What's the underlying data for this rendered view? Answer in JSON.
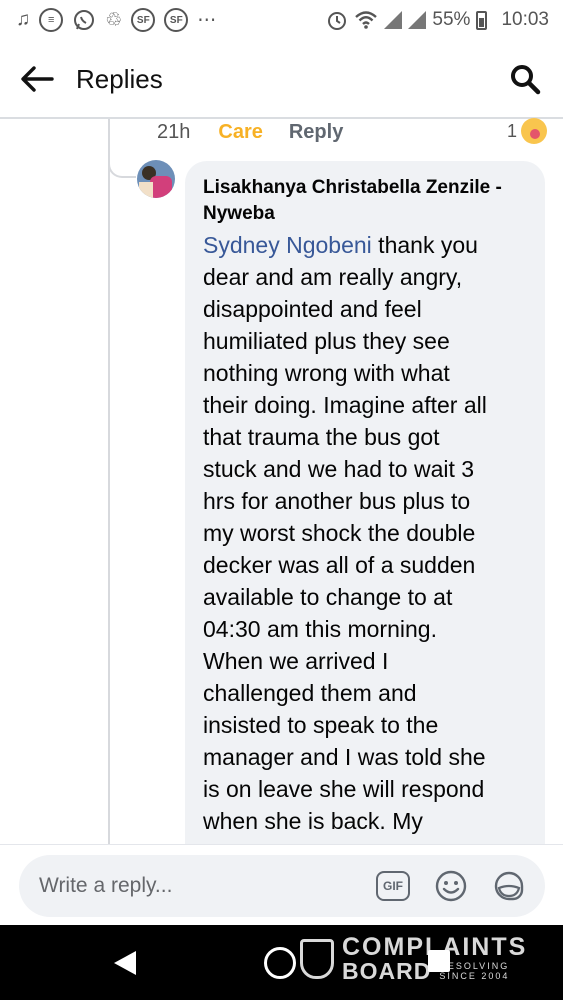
{
  "status_bar": {
    "battery_percent": "55%",
    "time": "10:03",
    "icons": [
      "music-note-icon",
      "messenger-icon",
      "whatsapp-icon",
      "recycle-icon",
      "sf-icon",
      "sf-icon",
      "more-dots-icon",
      "alarm-icon",
      "wifi-icon",
      "signal-icon",
      "signal-icon",
      "battery-icon"
    ]
  },
  "header": {
    "title": "Replies",
    "back_icon": "arrow-left-icon",
    "search_icon": "search-icon"
  },
  "parent_comment_meta": {
    "time": "21h",
    "reaction_label": "Care",
    "reply_label": "Reply",
    "reaction_count": "1",
    "reaction_emoji": "care-emoji-icon",
    "reaction_color": "#f7b125"
  },
  "reply": {
    "author": "Lisakhanya Christabella Zenzile - Nyweba",
    "mention": "Sydney Ngobeni",
    "lines": [
      " thank you",
      "dear and am really angry,",
      "disappointed and feel",
      "humiliated plus they see",
      "nothing wrong with what",
      "their doing. Imagine after all",
      "that trauma the bus got",
      "stuck and we had to wait 3",
      "hrs for another bus plus to",
      "my worst shock the double",
      "decker was all of a sudden",
      "available to change to at",
      "04:30 am this morning.",
      "When we arrived I",
      "challenged them and",
      "insisted to speak to the",
      "manager and I was told she",
      "is on leave she will respond",
      "when she is back. My"
    ],
    "mention_color": "#385898"
  },
  "composer": {
    "placeholder": "Write a reply...",
    "gif_label": "GIF",
    "icons": [
      "gif-icon",
      "emoji-icon",
      "sticker-icon"
    ]
  },
  "watermark": {
    "line1": "COMPLAINTS",
    "line2": "BOARD",
    "line3": "RESOLVING",
    "line4": "SINCE 2004"
  }
}
